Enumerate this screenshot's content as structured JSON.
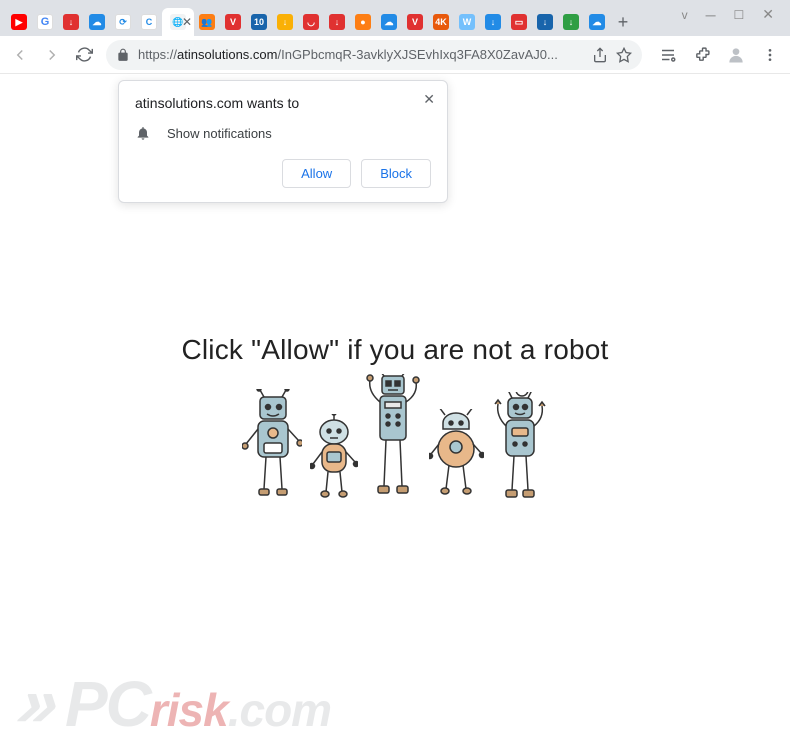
{
  "window": {
    "controls": {
      "chevron": "v",
      "minimize": "—",
      "maximize": "▢",
      "close": "✕"
    }
  },
  "tabs": {
    "items": [
      {
        "icon": "youtube"
      },
      {
        "icon": "google"
      },
      {
        "icon": "dl-red"
      },
      {
        "icon": "cloud-blue"
      },
      {
        "icon": "refresh"
      },
      {
        "icon": "c-blue"
      },
      {
        "icon": "globe",
        "active": true
      },
      {
        "icon": "users-orange"
      },
      {
        "icon": "v-red"
      },
      {
        "icon": "num10"
      },
      {
        "icon": "dl-yellow"
      },
      {
        "icon": "pocket"
      },
      {
        "icon": "dl-red2"
      },
      {
        "icon": "circle-orange"
      },
      {
        "icon": "cloud2"
      },
      {
        "icon": "v-red2"
      },
      {
        "icon": "4k"
      },
      {
        "icon": "w-blue"
      },
      {
        "icon": "dl-blue"
      },
      {
        "icon": "stop-red"
      },
      {
        "icon": "dl-navy"
      },
      {
        "icon": "dl-green"
      },
      {
        "icon": "cloud3"
      }
    ],
    "new_tab": "+",
    "close": "✕"
  },
  "toolbar": {
    "url_protocol": "https://",
    "url_host": "atinsolutions.com",
    "url_path": "/InGPbcmqR-3avklyXJSEvhIxq3FA8X0ZavAJ0..."
  },
  "permission": {
    "title": "atinsolutions.com wants to",
    "option": "Show notifications",
    "allow": "Allow",
    "block": "Block",
    "close": "✕"
  },
  "page": {
    "message": "Click \"Allow\"   if you are not   a robot"
  },
  "watermark": {
    "arrow": "»",
    "pc": "PC",
    "risk": "risk",
    "com": ".com"
  }
}
